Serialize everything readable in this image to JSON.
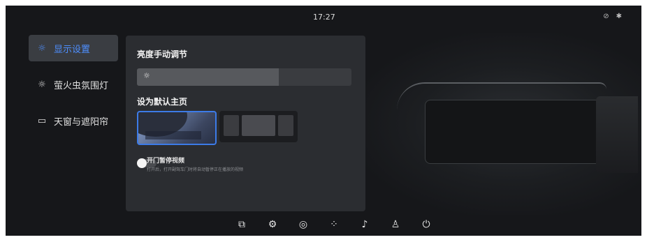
{
  "status_bar": {
    "time": "17:27",
    "icons": [
      "link-icon",
      "bluetooth-icon"
    ]
  },
  "sidebar": {
    "items": [
      {
        "label": "显示设置",
        "icon": "sun-icon",
        "active": true
      },
      {
        "label": "萤火虫氛围灯",
        "icon": "sun-icon",
        "active": false
      },
      {
        "label": "天窗与遮阳帘",
        "icon": "sunroof-icon",
        "active": false
      }
    ]
  },
  "panel": {
    "brightness_title": "亮度手动调节",
    "brightness_level": 0.66,
    "homepage_title": "设为默认主页",
    "thumbnails": [
      {
        "selected": true
      },
      {
        "selected": false
      }
    ],
    "door_toggle": {
      "title": "开门暂停视频",
      "description": "打开后，打开副驾车门时将自动暂停正在播放的视频",
      "on": false
    }
  },
  "dock": {
    "icons": [
      "window-icon",
      "settings-icon",
      "planet-icon",
      "apps-icon",
      "music-icon",
      "person-icon",
      "power-icon"
    ]
  },
  "colors": {
    "accent": "#4e8fff",
    "background": "#16171a",
    "panel": "#2b2d31"
  }
}
